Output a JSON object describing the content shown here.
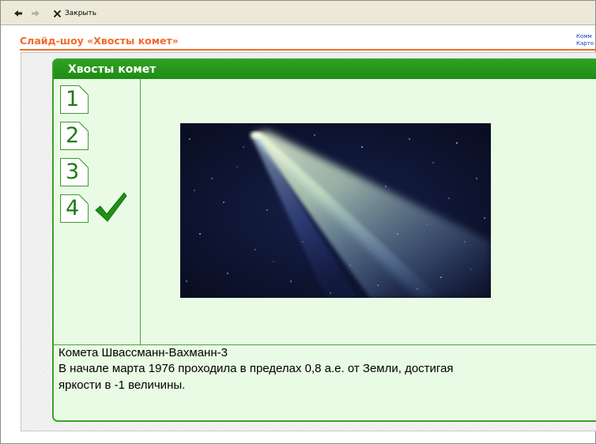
{
  "toolbar": {
    "back_icon": "arrow-left-icon",
    "forward_icon": "arrow-right-icon",
    "close_icon": "close-icon",
    "close_label": "Закрыть"
  },
  "page": {
    "title": "Слайд-шоу «Хвосты комет»",
    "side_links": [
      "Комм",
      "Карто"
    ]
  },
  "slide": {
    "header_title": "Хвосты комет",
    "numbers": [
      "1",
      "2",
      "3",
      "4"
    ],
    "current": "4",
    "current_marker_icon": "checkmark-icon",
    "image_alt": "comet-photo",
    "caption_title": "Комета Швассманн-Вахманн-3",
    "caption_text_line1": "В начале марта 1976 проходила в пределах 0,8 а.е. от Земли, достигая",
    "caption_text_line2": "яркости в -1 величины."
  },
  "colors": {
    "accent_orange": "#f26a2b",
    "slide_green": "#2ea121",
    "slide_background": "#e9fbe4",
    "number_green": "#1c7d12"
  }
}
